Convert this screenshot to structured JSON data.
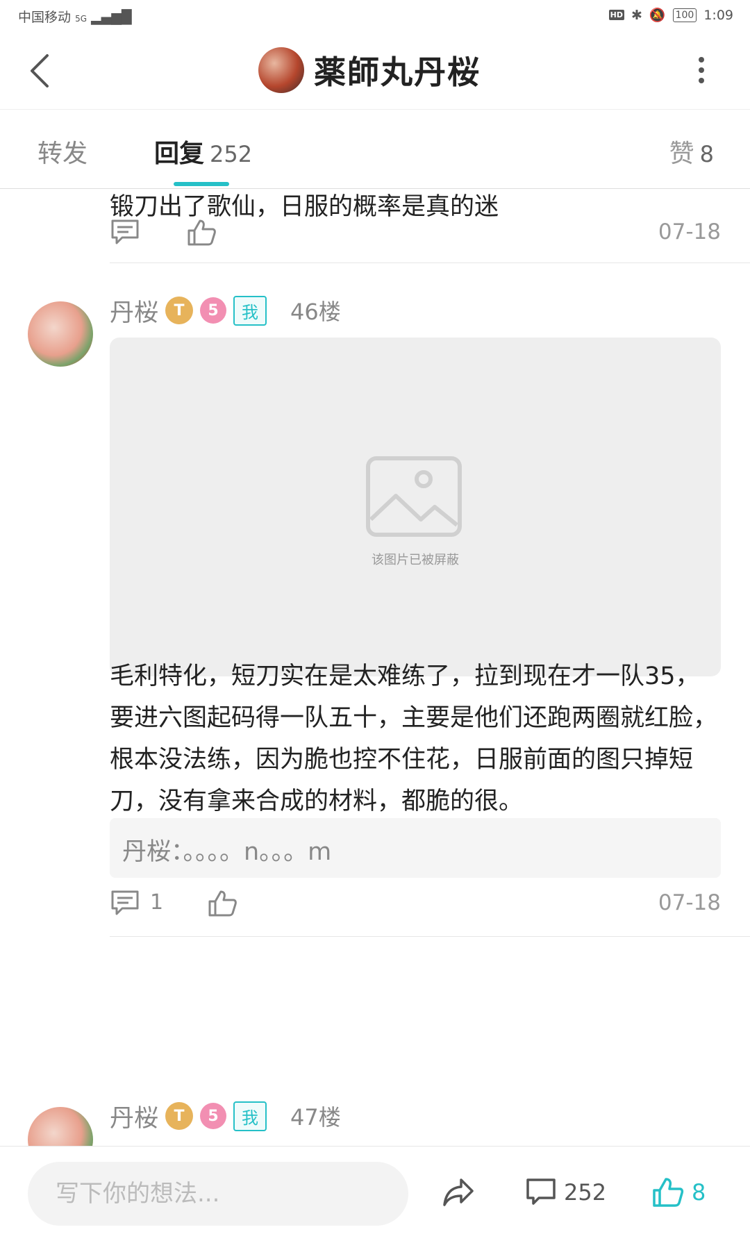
{
  "status_bar": {
    "carrier": "中国移动",
    "signal": "5G",
    "battery": "100",
    "time": "1:09",
    "hd": "HD"
  },
  "header": {
    "title": "薬師丸丹桜"
  },
  "tabs": {
    "forward": "转发",
    "reply": "回复",
    "reply_count": "252",
    "like": "赞",
    "like_count": "8"
  },
  "posts": [
    {
      "text": "锻刀出了歌仙，日服的概率是真的迷",
      "date": "07-18",
      "comment_count": ""
    },
    {
      "author": "丹桜",
      "badge_t": "T",
      "badge_lv": "5",
      "me_badge": "我",
      "floor": "46楼",
      "blocked_image_text": "该图片已被屏蔽",
      "text": "毛利特化，短刀实在是太难练了，拉到现在才一队35，要进六图起码得一队五十，主要是他们还跑两圈就红脸，根本没法练，因为脆也控不住花，日服前面的图只掉短刀，没有拿来合成的材料，都脆的很。",
      "quote": "丹桜：。。。。n。。。m",
      "comment_count": "1",
      "date": "07-18"
    },
    {
      "author": "丹桜",
      "badge_t": "T",
      "badge_lv": "5",
      "me_badge": "我",
      "floor": "47楼"
    }
  ],
  "bottom_bar": {
    "placeholder": "写下你的想法...",
    "comment_count": "252",
    "like_count": "8"
  },
  "colors": {
    "accent": "#25c0c7"
  }
}
